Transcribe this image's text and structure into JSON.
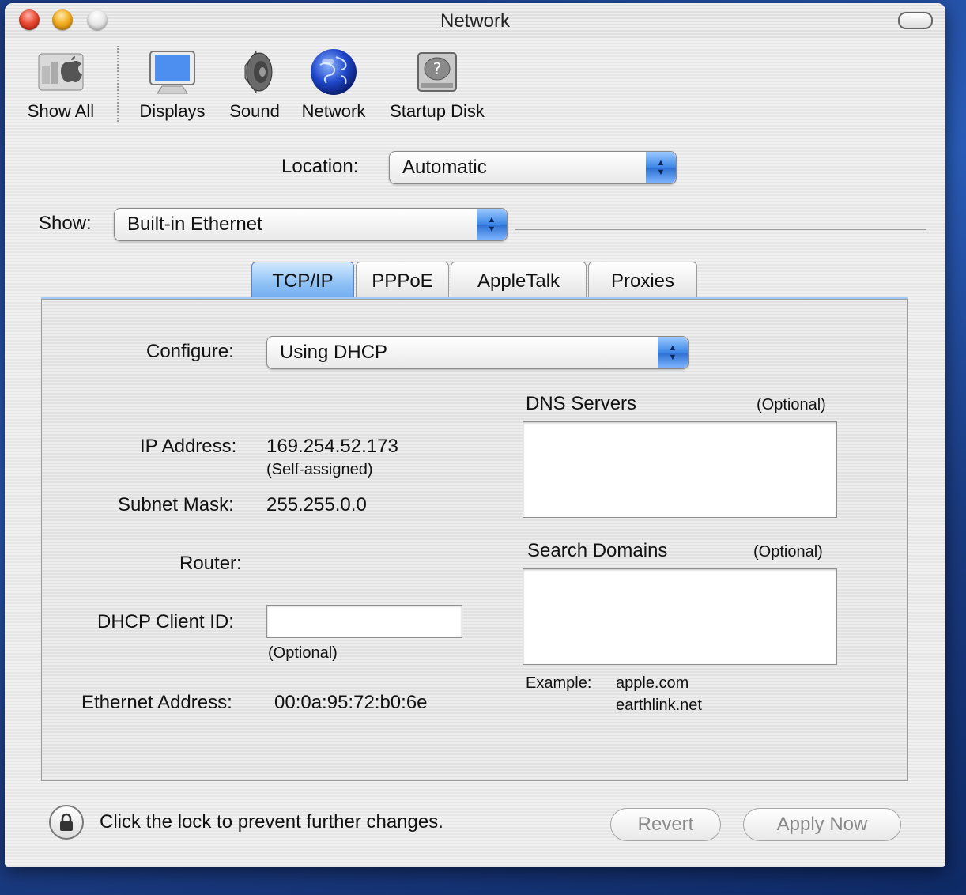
{
  "window": {
    "title": "Network"
  },
  "toolbar": {
    "items": [
      {
        "label": "Show All",
        "icon": "show-all-icon"
      },
      {
        "label": "Displays",
        "icon": "displays-icon"
      },
      {
        "label": "Sound",
        "icon": "sound-icon"
      },
      {
        "label": "Network",
        "icon": "network-globe-icon"
      },
      {
        "label": "Startup Disk",
        "icon": "startup-disk-icon"
      }
    ]
  },
  "location": {
    "label": "Location:",
    "value": "Automatic"
  },
  "show": {
    "label": "Show:",
    "value": "Built-in Ethernet"
  },
  "tabs": [
    {
      "label": "TCP/IP",
      "active": true
    },
    {
      "label": "PPPoE",
      "active": false
    },
    {
      "label": "AppleTalk",
      "active": false
    },
    {
      "label": "Proxies",
      "active": false
    }
  ],
  "tcpip": {
    "configure_label": "Configure:",
    "configure_value": "Using DHCP",
    "ip_label": "IP Address:",
    "ip_value": "169.254.52.173",
    "ip_note": "(Self-assigned)",
    "subnet_label": "Subnet Mask:",
    "subnet_value": "255.255.0.0",
    "router_label": "Router:",
    "router_value": "",
    "dhcp_label": "DHCP Client ID:",
    "dhcp_value": "",
    "dhcp_note": "(Optional)",
    "ethernet_label": "Ethernet Address:",
    "ethernet_value": "00:0a:95:72:b0:6e",
    "dns_label": "DNS Servers",
    "dns_note": "(Optional)",
    "dns_value": "",
    "search_label": "Search Domains",
    "search_note": "(Optional)",
    "search_value": "",
    "example_label": "Example:",
    "example_1": "apple.com",
    "example_2": "earthlink.net"
  },
  "footer": {
    "lock_text": "Click the lock to prevent further changes.",
    "revert_label": "Revert",
    "apply_label": "Apply Now"
  },
  "colors": {
    "accent": "#3b86e6",
    "tab_active": "#8fc2f5",
    "desktop": "#1d3f8a"
  }
}
